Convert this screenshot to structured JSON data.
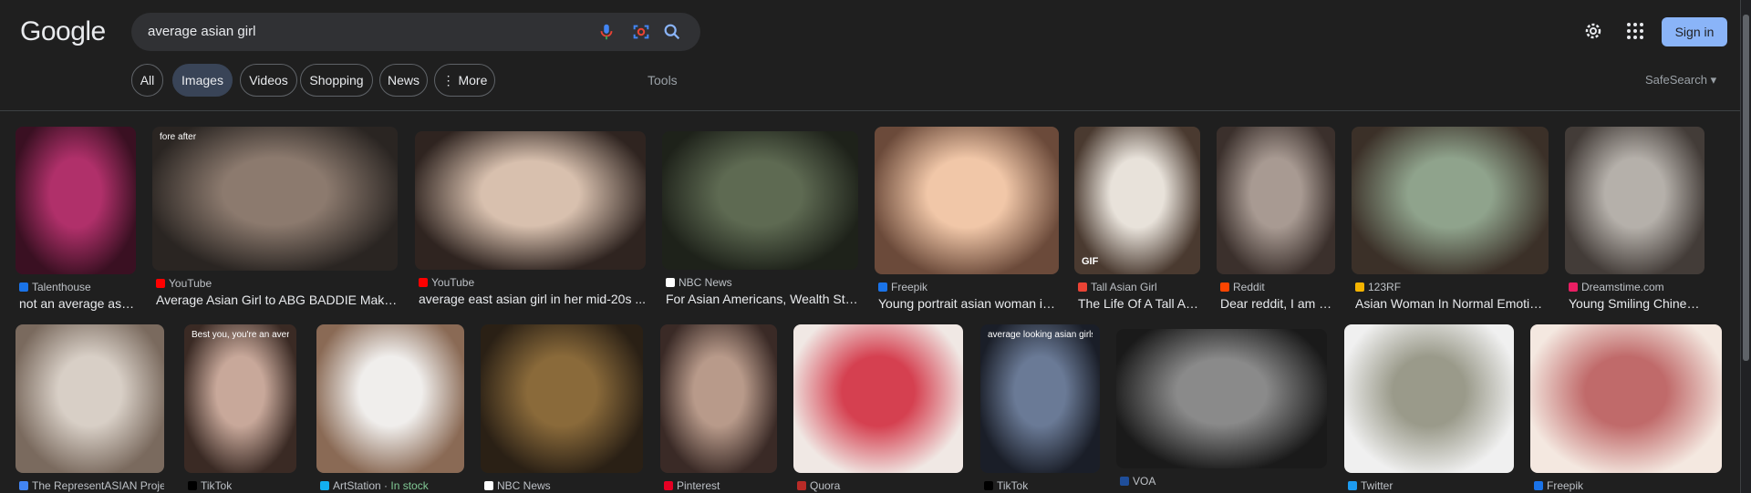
{
  "header": {
    "logo": "Google",
    "query": "average asian girl",
    "sign_in": "Sign in"
  },
  "tabs": [
    "All",
    "Images",
    "Videos",
    "Shopping",
    "News",
    "More"
  ],
  "active_tab": "Images",
  "tools": "Tools",
  "safesearch": "SafeSearch",
  "results": [
    {
      "source": "Talenthouse",
      "title": "not an average asia...",
      "fav": "#1a73e8",
      "tone": [
        "#b0306a",
        "#3a1022"
      ]
    },
    {
      "source": "YouTube",
      "title": "Average Asian Girl to ABG BADDIE Makeup ...",
      "fav": "#ff0000",
      "tone": [
        "#8c7a6e",
        "#2a2522"
      ],
      "overlay": "fore        after"
    },
    {
      "source": "YouTube",
      "title": "average east asian girl in her mid-20s ...",
      "fav": "#ff0000",
      "tone": [
        "#d8c0ae",
        "#2f2420"
      ]
    },
    {
      "source": "NBC News",
      "title": "For Asian Americans, Wealth Stere...",
      "fav": "#ffffff",
      "tone": [
        "#5e6a52",
        "#1e221a"
      ]
    },
    {
      "source": "Freepik",
      "title": "Young portrait asian woman iso...",
      "fav": "#1a73e8",
      "tone": [
        "#f1c7a8",
        "#6b4a3a"
      ]
    },
    {
      "source": "Tall Asian Girl",
      "title": "The Life Of A Tall Asi...",
      "fav": "#ea4335",
      "tone": [
        "#e8e2da",
        "#4a3a30"
      ],
      "badge": "GIF"
    },
    {
      "source": "Reddit",
      "title": "Dear reddit, I am a t...",
      "fav": "#ff4500",
      "tone": [
        "#a89a92",
        "#3b302c"
      ]
    },
    {
      "source": "123RF",
      "title": "Asian Woman In Normal Emotion ...",
      "fav": "#f5b400",
      "tone": [
        "#8fa38c",
        "#3b3028"
      ]
    },
    {
      "source": "Dreamstime.com",
      "title": "Young Smiling Chinese Girl...",
      "fav": "#e91e63",
      "tone": [
        "#b5b0aa",
        "#433c38"
      ]
    },
    {
      "source": "The RepresentASIAN Proje...",
      "title": "",
      "fav": "#4285f4",
      "tone": [
        "#d8cfc6",
        "#7a6a5e"
      ]
    },
    {
      "source": "TikTok",
      "title": "",
      "fav": "#000000",
      "tone": [
        "#c8a89a",
        "#3a2a24"
      ],
      "overlay": "Best you, you're an average Asian girl"
    },
    {
      "source": "ArtStation · ",
      "stock": "In stock",
      "title": "",
      "fav": "#13aff0",
      "tone": [
        "#f0eeec",
        "#8a6a55"
      ]
    },
    {
      "source": "NBC News",
      "title": "",
      "fav": "#ffffff",
      "tone": [
        "#8a6a3a",
        "#2a2015"
      ]
    },
    {
      "source": "Pinterest",
      "title": "",
      "fav": "#e60023",
      "tone": [
        "#b89a8a",
        "#3a2a26"
      ]
    },
    {
      "source": "Quora",
      "title": "",
      "fav": "#b92b27",
      "tone": [
        "#d54050",
        "#f0e8e4"
      ]
    },
    {
      "source": "TikTok",
      "title": "",
      "fav": "#000000",
      "tone": [
        "#6a7a96",
        "#1a1e28"
      ],
      "overlay": "average looking asian girls"
    },
    {
      "source": "VOA",
      "title": "",
      "fav": "#1f4e9a",
      "tone": [
        "#8a8a8a",
        "#1a1a1a"
      ]
    },
    {
      "source": "Twitter",
      "title": "",
      "fav": "#1d9bf0",
      "tone": [
        "#9a9a8a",
        "#f0f0f0"
      ]
    },
    {
      "source": "Freepik",
      "title": "",
      "fav": "#1a73e8",
      "tone": [
        "#c06a6a",
        "#f4e8e0"
      ]
    }
  ]
}
